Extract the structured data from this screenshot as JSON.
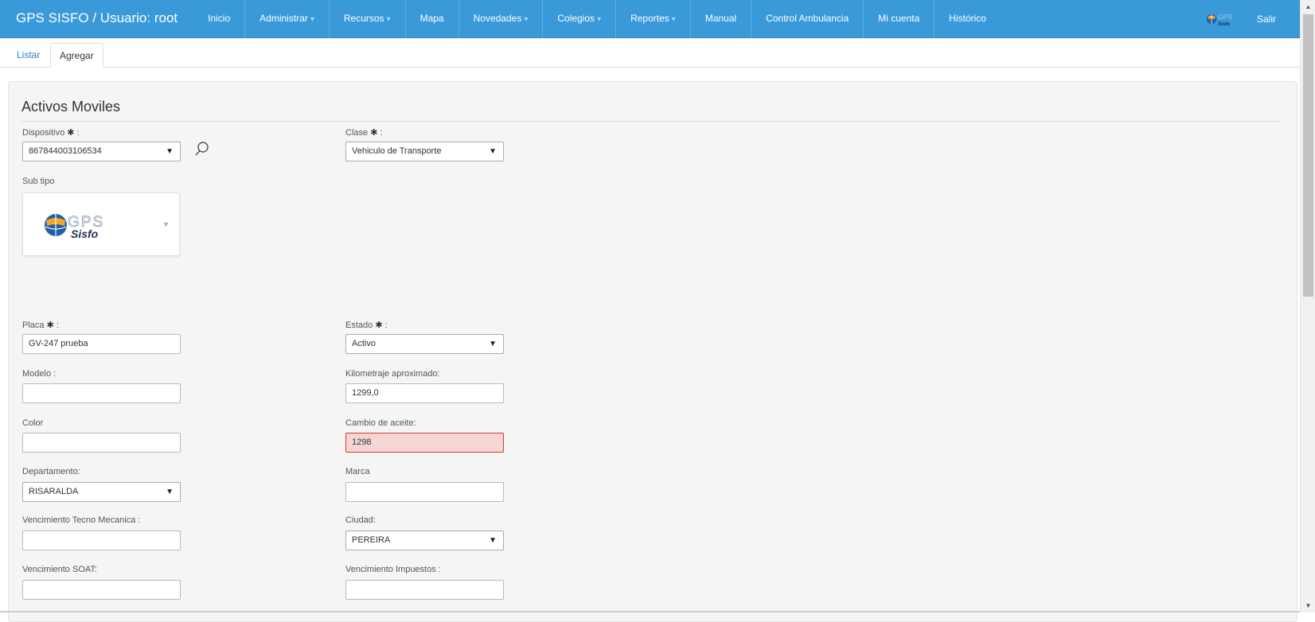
{
  "navbar": {
    "brand": "GPS SISFO / Usuario: root",
    "items": [
      {
        "label": "Inicio",
        "dropdown": false
      },
      {
        "label": "Administrar",
        "dropdown": true
      },
      {
        "label": "Recursos",
        "dropdown": true
      },
      {
        "label": "Mapa",
        "dropdown": false
      },
      {
        "label": "Novedades",
        "dropdown": true
      },
      {
        "label": "Colegios",
        "dropdown": true
      },
      {
        "label": "Reportes",
        "dropdown": true
      },
      {
        "label": "Manual",
        "dropdown": false
      },
      {
        "label": "Control Ambulancia",
        "dropdown": false
      },
      {
        "label": "Mi cuenta",
        "dropdown": false
      },
      {
        "label": "Histórico",
        "dropdown": false
      }
    ],
    "logo_text": "GPS",
    "logo_subtext": "Sisfo",
    "logout": "Salir",
    "color": "#3a9ad9"
  },
  "tabs": {
    "list": "Listar",
    "add": "Agregar"
  },
  "form": {
    "title": "Activos Moviles",
    "dispositivo": {
      "label": "Dispositivo",
      "value": "867844003106534"
    },
    "clase": {
      "label": "Clase",
      "value": "Vehiculo de Transporte"
    },
    "subtipo": {
      "label": "Sub tipo",
      "logo_text": "GPS",
      "logo_subtext": "Sisfo"
    },
    "placa": {
      "label": "Placa",
      "value": "GV-247 prueba"
    },
    "estado": {
      "label": "Estado",
      "value": "Activo"
    },
    "modelo": {
      "label": "Modelo :",
      "value": ""
    },
    "kilometraje": {
      "label": "Kilometraje aproximado:",
      "value": "1299,0"
    },
    "color": {
      "label": "Color",
      "value": ""
    },
    "cambio_aceite": {
      "label": "Cambio de aceite:",
      "value": "1298"
    },
    "departamento": {
      "label": "Departamento:",
      "value": "RISARALDA"
    },
    "marca": {
      "label": "Marca",
      "value": ""
    },
    "tecno": {
      "label": "Vencimiento Tecno Mecanica :",
      "value": ""
    },
    "ciudad": {
      "label": "Ciudad:",
      "value": "PEREIRA"
    },
    "soat": {
      "label": "Vencimiento SOAT:",
      "value": ""
    },
    "impuestos": {
      "label": "Vencimiento Impuestos :",
      "value": ""
    },
    "error_color": "#d43a3a"
  }
}
